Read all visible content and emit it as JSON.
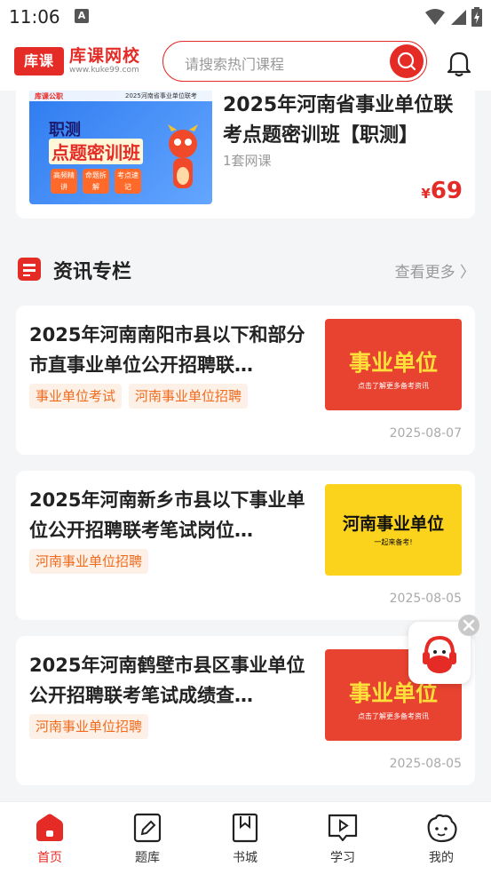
{
  "status": {
    "time": "11:06"
  },
  "header": {
    "logo_mark": "库课",
    "logo_name": "库课网校",
    "logo_url": "www.kuke99.com",
    "search_placeholder": "请搜索热门课程"
  },
  "course": {
    "title": "2025年河南省事业单位联考点题密训班【职测】",
    "count": "1套网课",
    "price_symbol": "¥",
    "price": "69",
    "image": {
      "brand": "库课公职",
      "subtitle": "2025河南省事业单位联考",
      "line1": "职测",
      "line2": "点题密训班",
      "pills": [
        "高频精讲",
        "命题拆解",
        "考点速记"
      ]
    }
  },
  "section": {
    "title": "资讯专栏",
    "more": "查看更多"
  },
  "news": [
    {
      "title": "2025年河南南阳市县以下和部分市直事业单位公开招聘联…",
      "tags": [
        "事业单位考试",
        "河南事业单位招聘"
      ],
      "image_big": "事业单位",
      "image_small": "点击了解更多备考资讯",
      "date": "2025-08-07"
    },
    {
      "title": "2025年河南新乡市县以下事业单位公开招聘联考笔试岗位…",
      "tags": [
        "河南事业单位招聘"
      ],
      "image_big": "河南事业单位",
      "image_small": "一起来备考!",
      "date": "2025-08-05"
    },
    {
      "title": "2025年河南鹤壁市县区事业单位公开招聘联考笔试成绩查…",
      "tags": [
        "河南事业单位招聘"
      ],
      "image_big": "事业单位",
      "image_small": "点击了解更多备考资讯",
      "date": "2025-08-05"
    }
  ],
  "tabs": [
    {
      "label": "首页",
      "icon": "home-icon",
      "active": true
    },
    {
      "label": "题库",
      "icon": "edit-icon",
      "active": false
    },
    {
      "label": "书城",
      "icon": "bookmark-icon",
      "active": false
    },
    {
      "label": "学习",
      "icon": "play-book-icon",
      "active": false
    },
    {
      "label": "我的",
      "icon": "profile-icon",
      "active": false
    }
  ],
  "colors": {
    "brand": "#e52b26",
    "tag_text": "#f06b1e",
    "tag_bg": "#fdf0e6"
  }
}
